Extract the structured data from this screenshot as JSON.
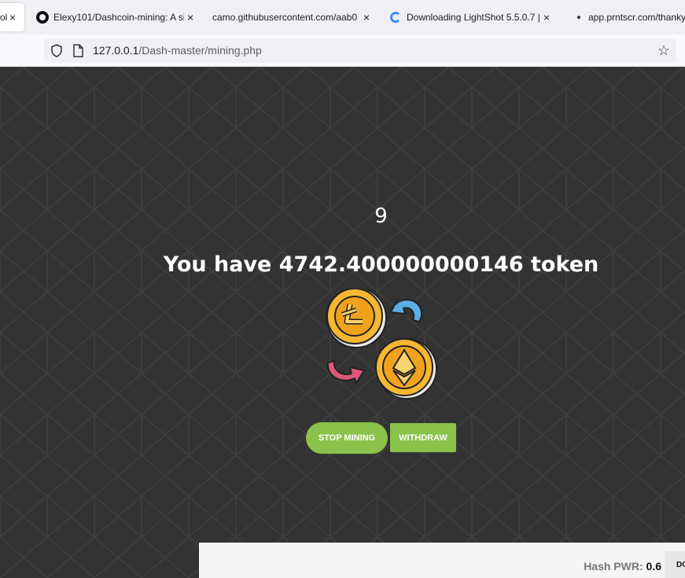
{
  "browser": {
    "tabs": [
      {
        "title": "ol",
        "icon": "page-icon",
        "active": true
      },
      {
        "title": "Elexy101/Dashcoin-mining: A si",
        "icon": "github-icon",
        "active": false
      },
      {
        "title": "camo.githubusercontent.com/aab0",
        "icon": "none",
        "active": false
      },
      {
        "title": "Downloading LightShot 5.5.0.7 |",
        "icon": "loading-icon",
        "active": false
      },
      {
        "title": "app.prntscr.com/thanky",
        "icon": "dot-icon",
        "active": false
      }
    ],
    "close_glyph": "×",
    "url_host": "127.0.0.1",
    "url_path": "/Dash-master/mining.php"
  },
  "mining": {
    "counter": "9",
    "token_text": "You have 4742.400000000146 token",
    "stop_label": "STOP MINING",
    "withdraw_label": "WITHDRAW",
    "coins_image": "crypto-exchange-icon"
  },
  "footer": {
    "hash_label": "Hash PWR:",
    "hash_value": "0.6",
    "side_button": "DO"
  },
  "colors": {
    "background": "#333333",
    "button_green": "#8bc34a",
    "litecoin_gold": "#f7b731",
    "arrow_blue": "#5aaee6",
    "arrow_pink": "#e0567a"
  }
}
